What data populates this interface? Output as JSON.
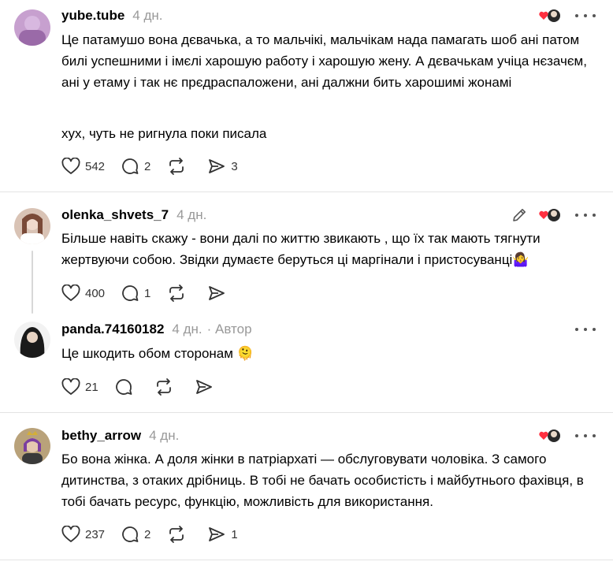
{
  "posts": [
    {
      "username": "yube.tube",
      "time": "4 дн.",
      "text": "Це патамушо вона дєвачька, а то мальчікі, мальчікам нада памагать шоб ані патом билі успешними і імєлі харошую работу і харошую жену. А дєвачькам учіца нєзачєм, ані у етаму і так нє прєдраспаложени, ані далжни бить харошимі жонамі",
      "text2": "хух, чуть не ригнула поки писала",
      "likes": "542",
      "replies": "2",
      "reposts": "",
      "shares": "3"
    },
    {
      "username": "olenka_shvets_7",
      "time": "4 дн.",
      "text": "Більше навіть скажу - вони далі по життю звикають , що їх так мають тягнути жертвуючи собою. Звідки думаєте беруться ці маргінали і пристосуванці🤷‍♀️",
      "likes": "400",
      "replies": "1",
      "reposts": "",
      "shares": ""
    },
    {
      "username": "panda.74160182",
      "time": "4 дн.",
      "author_badge": "· Автор",
      "text": "Це шкодить обом сторонам 🫠",
      "likes": "21",
      "replies": "",
      "reposts": "",
      "shares": ""
    },
    {
      "username": "bethy_arrow",
      "time": "4 дн.",
      "text": "Бо вона жінка. А доля жінки в патріархаті — обслуговувати чоловіка. З самого дитинства, з отаких дрібниць. В тобі не бачать особистість і майбутнього фахівця, в тобі бачать ресурс, функцію, можливість для використання.",
      "likes": "237",
      "replies": "2",
      "reposts": "",
      "shares": "1"
    }
  ],
  "icons": {
    "like": "heart-icon",
    "reply": "comment-icon",
    "repost": "repost-icon",
    "share": "share-icon",
    "more": "more-icon",
    "edit": "pencil-icon"
  },
  "colors": {
    "liked_heart": "#ff3040",
    "muted": "#999999"
  }
}
